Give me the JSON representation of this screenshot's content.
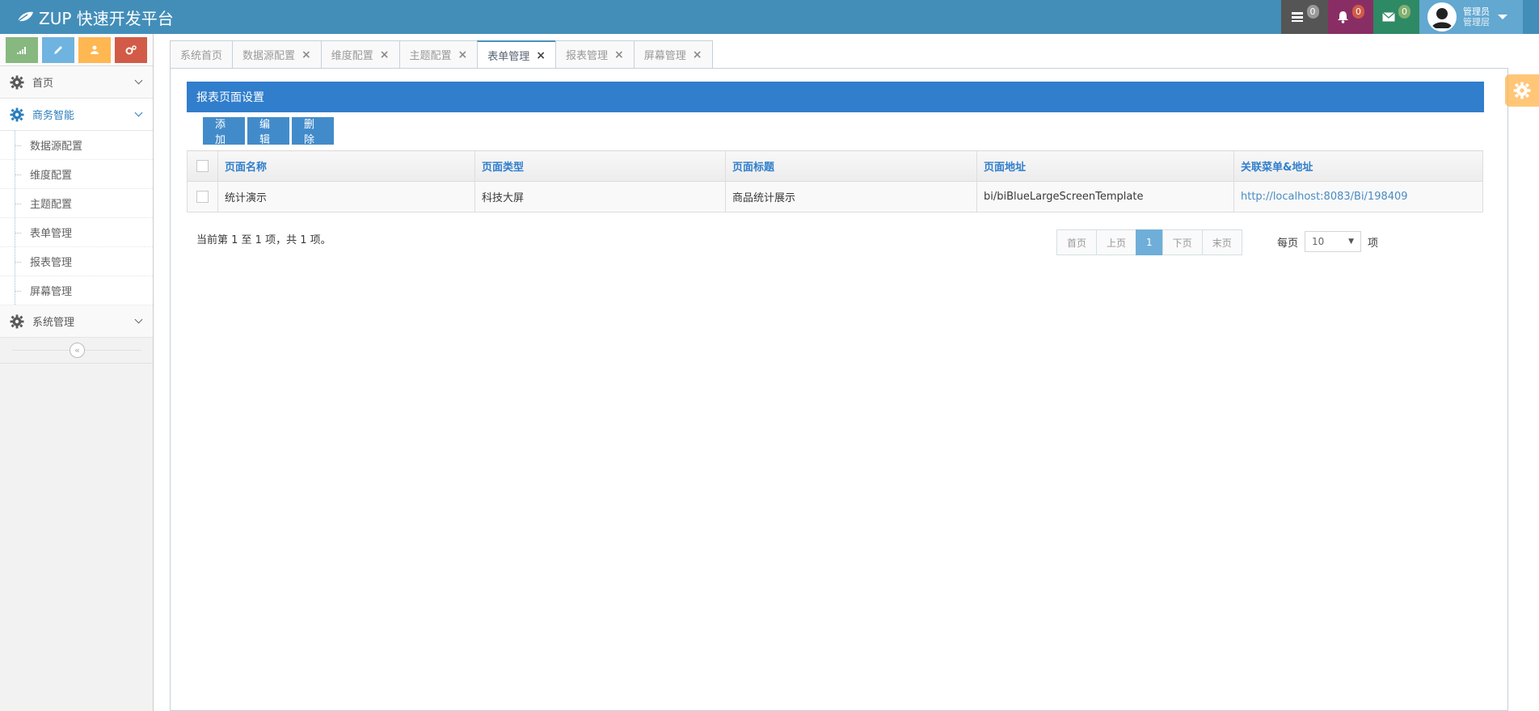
{
  "app": {
    "title": "ZUP 快速开发平台"
  },
  "navbar": {
    "tasks_count": "0",
    "notifications_count": "0",
    "messages_count": "0",
    "user": {
      "name": "管理员",
      "role": "管理层"
    }
  },
  "sidebar": {
    "shortcuts": [
      {
        "icon": "signal-icon",
        "color": "#87b87f"
      },
      {
        "icon": "pencil-icon",
        "color": "#6fb3e0"
      },
      {
        "icon": "users-icon",
        "color": "#ffb752"
      },
      {
        "icon": "cogs-icon",
        "color": "#d15b47"
      }
    ],
    "menu": {
      "home": "首页",
      "bi": "商务智能",
      "system": "系统管理"
    },
    "submenu": [
      "数据源配置",
      "维度配置",
      "主题配置",
      "表单管理",
      "报表管理",
      "屏幕管理"
    ],
    "collapse_glyph": "«"
  },
  "tabs": [
    {
      "label": "系统首页",
      "closable": false
    },
    {
      "label": "数据源配置",
      "closable": true
    },
    {
      "label": "维度配置",
      "closable": true
    },
    {
      "label": "主题配置",
      "closable": true
    },
    {
      "label": "表单管理",
      "closable": true,
      "active": true
    },
    {
      "label": "报表管理",
      "closable": true
    },
    {
      "label": "屏幕管理",
      "closable": true
    }
  ],
  "panel": {
    "title": "报表页面设置"
  },
  "toolbar": {
    "add": "添加",
    "edit": "编辑",
    "delete": "删除"
  },
  "table": {
    "columns": [
      "页面名称",
      "页面类型",
      "页面标题",
      "页面地址",
      "关联菜单&地址"
    ],
    "rows": [
      [
        "统计演示",
        "科技大屏",
        "商品统计展示",
        "bi/biBlueLargeScreenTemplate",
        "http://localhost:8083/Bi/198409"
      ]
    ]
  },
  "pagination": {
    "info": "当前第 1 至 1 项，共 1 项。",
    "first": "首页",
    "prev": "上页",
    "current": "1",
    "next": "下页",
    "last": "末页",
    "per_page_label": "每页",
    "per_page_value": "10",
    "per_page_suffix": "项"
  },
  "colors": {
    "navbar": "#438eb9",
    "panel_header": "#307ecc",
    "button": "#428bca",
    "settings": "#ffb44b"
  }
}
